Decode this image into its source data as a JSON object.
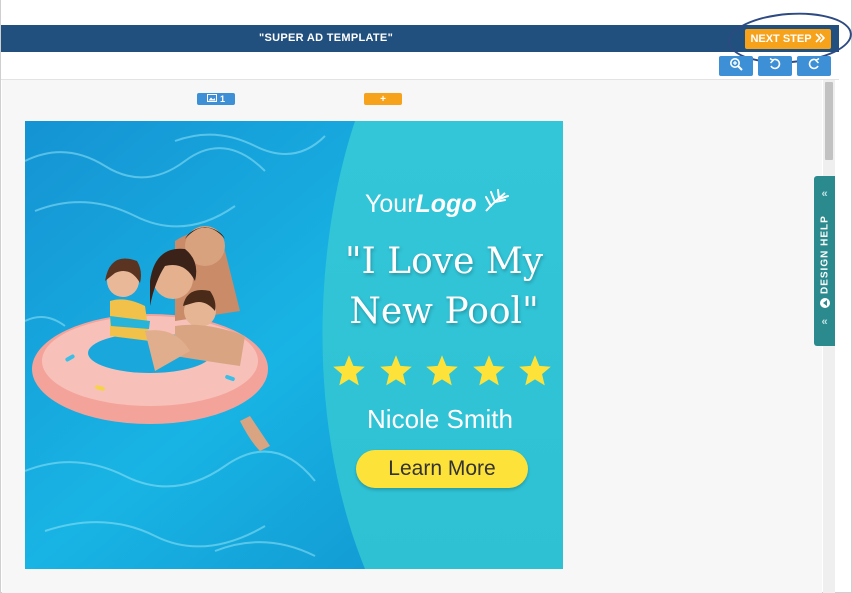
{
  "header": {
    "title": "\"SUPER AD TEMPLATE\"",
    "next_step_label": "NEXT STEP",
    "next_step_icon": "double-chevron-right-icon"
  },
  "toolbar": {
    "tools": [
      {
        "name": "zoom-in-icon"
      },
      {
        "name": "undo-icon"
      },
      {
        "name": "redo-icon"
      }
    ]
  },
  "canvas_tabs": {
    "image_tab_count": "1",
    "add_tab_label": "+"
  },
  "ad": {
    "logo_light": "Your",
    "logo_bold": "Logo",
    "quote_line1": "\"I Love My",
    "quote_line2": "New Pool\"",
    "stars": 5,
    "name": "Nicole Smith",
    "cta_label": "Learn More"
  },
  "design_help": {
    "label": "DESIGN HELP"
  },
  "colors": {
    "header_bg": "#22507e",
    "next_step": "#f7a21b",
    "tool_btn": "#3d8fd6",
    "help_tab": "#2b8a8e",
    "cta": "#fde23a",
    "star": "#fde23a",
    "annotation_circle": "#2d4a82"
  }
}
